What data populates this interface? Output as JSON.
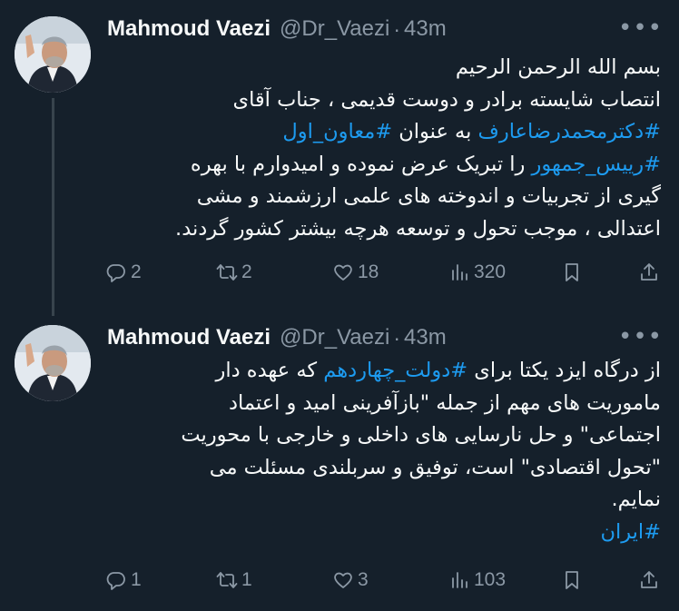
{
  "tweets": [
    {
      "name": "Mahmoud Vaezi",
      "handle": "@Dr_Vaezi",
      "separator": "·",
      "time": "43m",
      "more": "•••",
      "lines": [
        [
          "بسم الله الرحمن الرحیم"
        ],
        [
          "انتصاب شایسته برادر و دوست قدیمی ، جناب آقای"
        ],
        [
          "",
          "#دکترمحمدرضاعارف",
          " به عنوان ",
          "#معاون_اول"
        ],
        [
          "",
          "#رییس_جمهور",
          "  را  تبریک عرض نموده و امیدوارم با بهره"
        ],
        [
          "گیری از تجربیات و اندوخته های علمی ارزشمند و مشی"
        ],
        [
          "اعتدالی ، موجب تحول و توسعه هرچه بیشتر کشور گردند."
        ]
      ],
      "stats": {
        "replies": "2",
        "retweets": "2",
        "likes": "18",
        "views": "320"
      }
    },
    {
      "name": "Mahmoud Vaezi",
      "handle": "@Dr_Vaezi",
      "separator": "·",
      "time": "43m",
      "more": "•••",
      "lines": [
        [
          "از درگاه ایزد یکتا برای ",
          "#دولت_چهاردهم",
          " که عهده دار"
        ],
        [
          "ماموریت های مهم از جمله \"بازآفرینی امید و اعتماد"
        ],
        [
          "اجتماعی\" و حل نارسایی های داخلی و خارجی با محوریت"
        ],
        [
          "\"تحول اقتصادی\" است، توفیق و سربلندی مسئلت می"
        ],
        [
          "نمایم."
        ],
        [
          "",
          "#ایران"
        ]
      ],
      "stats": {
        "replies": "1",
        "retweets": "1",
        "likes": "3",
        "views": "103"
      }
    }
  ],
  "colors": {
    "background": "#15202b",
    "text": "#f7f9f9",
    "muted": "#8b98a5",
    "link": "#1d9bf0"
  },
  "icons": [
    "reply-icon",
    "retweet-icon",
    "like-icon",
    "views-icon",
    "bookmark-icon",
    "share-icon",
    "more-icon"
  ]
}
